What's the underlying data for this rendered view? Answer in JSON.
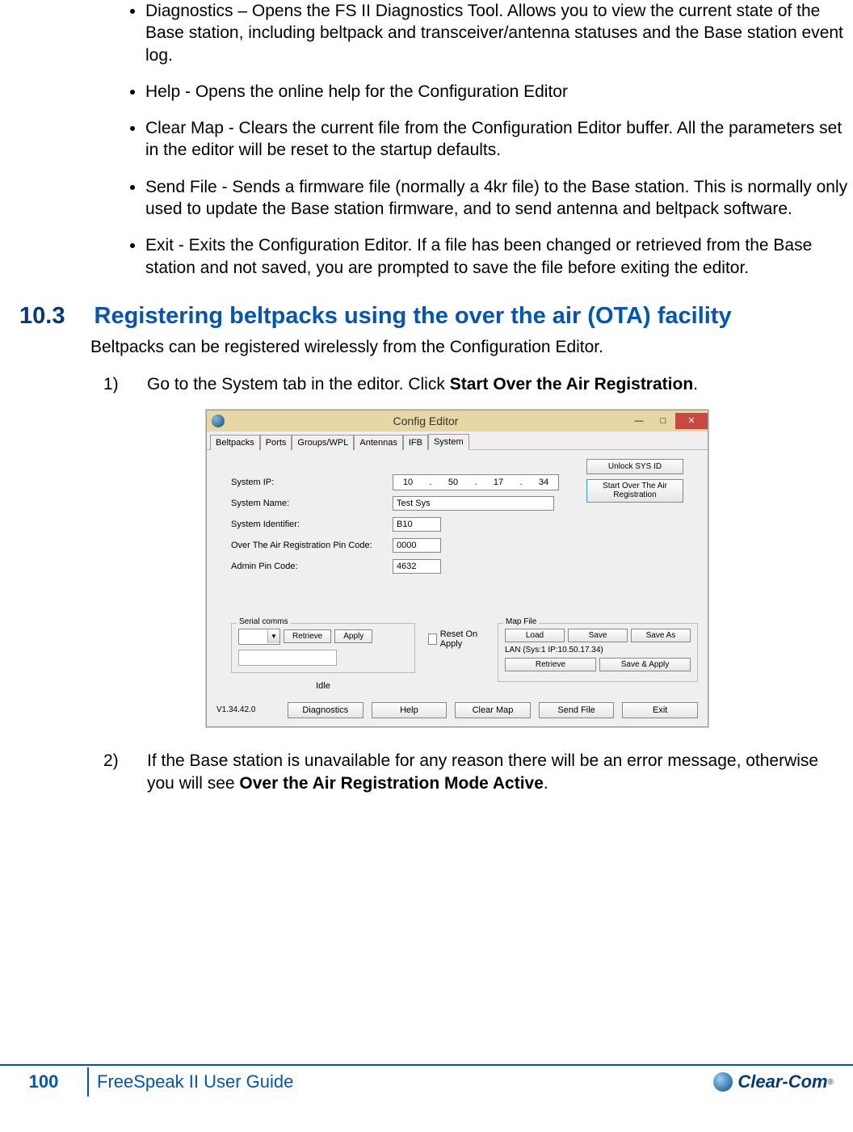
{
  "bullets": [
    "Diagnostics – Opens the FS II Diagnostics Tool. Allows you to view the current state of the Base station, including beltpack and transceiver/antenna statuses and the Base station event log.",
    "Help -  Opens the online help for the Configuration Editor",
    "Clear Map - Clears the current file from the Configuration Editor buffer. All the parameters set in the editor will be reset to the startup defaults.",
    "Send File - Sends a firmware file (normally a 4kr file) to the Base station. This is normally only used to update the Base station firmware, and to send antenna and beltpack software.",
    "Exit - Exits the Configuration Editor. If a file has been changed or retrieved from the Base station and not saved, you are prompted to save the file before exiting the editor."
  ],
  "section": {
    "num": "10.3",
    "title": "Registering beltpacks using the over the air (OTA) facility"
  },
  "intro": "Beltpacks can be registered wirelessly from the Configuration Editor.",
  "steps": {
    "1": {
      "num": "1)",
      "pre": "Go to the System tab in the editor. Click ",
      "bold": "Start Over the Air Registration",
      "post": "."
    },
    "2": {
      "num": "2)",
      "pre": "If the Base station is unavailable for any reason there will be an error message, otherwise you will see ",
      "bold": "Over the Air Registration Mode Active",
      "post": "."
    }
  },
  "screenshot": {
    "title": "Config Editor",
    "winbtns": {
      "min": "—",
      "max": "□",
      "close": "✕"
    },
    "tabs": [
      "Beltpacks",
      "Ports",
      "Groups/WPL",
      "Antennas",
      "IFB",
      "System"
    ],
    "fields": {
      "system_ip_label": "System IP:",
      "ip": [
        "10",
        "50",
        "17",
        "34"
      ],
      "system_name_label": "System Name:",
      "system_name": "Test Sys",
      "system_id_label": "System Identifier:",
      "system_id": "B10",
      "ota_pin_label": "Over The Air Registration Pin Code:",
      "ota_pin": "0000",
      "admin_pin_label": "Admin Pin Code:",
      "admin_pin": "4632"
    },
    "right_buttons": {
      "unlock": "Unlock SYS ID",
      "start_ota": "Start Over The Air Registration"
    },
    "serial": {
      "group": "Serial comms",
      "retrieve": "Retrieve",
      "apply": "Apply",
      "idle": "Idle"
    },
    "reset_label": "Reset On Apply",
    "map": {
      "group": "Map File",
      "load": "Load",
      "save": "Save",
      "saveas": "Save As",
      "lan": "LAN  (Sys:1 IP:10.50.17.34)",
      "retrieve": "Retrieve",
      "saveapply": "Save & Apply"
    },
    "footer": {
      "ver": "V1.34.42.0",
      "diag": "Diagnostics",
      "help": "Help",
      "clear": "Clear Map",
      "send": "Send File",
      "exit": "Exit"
    }
  },
  "footer": {
    "page": "100",
    "title": "FreeSpeak II User Guide",
    "logo": "Clear-Com",
    "reg": "®"
  }
}
